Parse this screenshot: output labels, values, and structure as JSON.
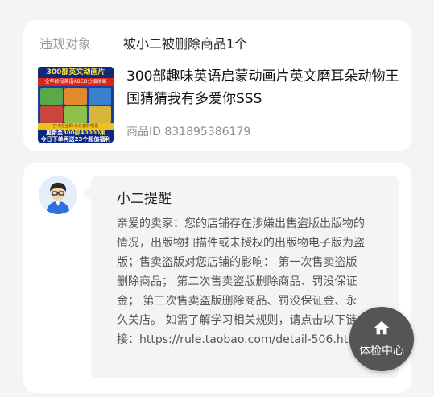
{
  "violation": {
    "label": "违规对象",
    "value": "被小二被删除商品1个"
  },
  "product": {
    "thumbnail": {
      "top_text": "300部英文动画片",
      "sub_text": "全年龄段英语ABCD分级动画",
      "strip_text": "打卡在全网  永久管好观看",
      "bottom_line1_a": "更新至",
      "bottom_line1_b": "300部40000集",
      "bottom_line2": "今日下单再送23个超值福利"
    },
    "title": "300部趣味英语启蒙动画片英文磨耳朵动物王国猜猜我有多爱你SSS",
    "id_label": "商品ID",
    "id_value": "831895386179"
  },
  "notice": {
    "avatar": "avatar-icon",
    "title": "小二提醒",
    "body": "亲爱的卖家：您的店铺存在涉嫌出售盗版出版物的情况，出版物扫描件或未授权的出版物电子版为盗版；售卖盗版对您店铺的影响： 第一次售卖盗版删除商品； 第二次售卖盗版删除商品、罚没保证金； 第三次售卖盗版删除商品、罚没保证金、永久关店。 如需了解学习相关规则，请点击以下链接：https://rule.taobao.com/detail-506.htm"
  },
  "fab": {
    "icon": "home-icon",
    "label": "体检中心"
  },
  "colors": {
    "page_bg": "#f4f4f4",
    "card_bg": "#ffffff",
    "fab_bg": "#555555"
  }
}
